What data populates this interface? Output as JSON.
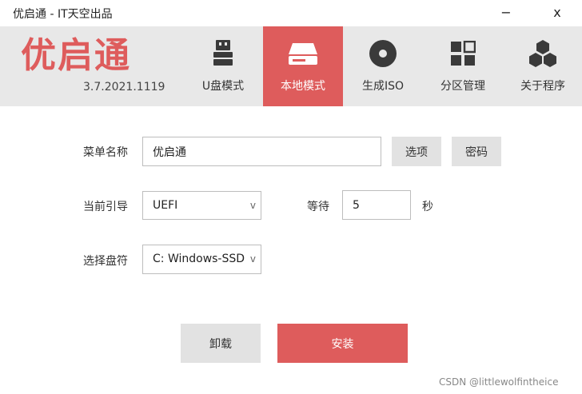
{
  "window": {
    "title": "优启通 - IT天空出品",
    "minimize_glyph": "−",
    "close_glyph": "x"
  },
  "header": {
    "logo_text": "优启通",
    "version": "3.7.2021.1119",
    "tabs": [
      {
        "label": "U盘模式",
        "icon": "usb-drive-icon",
        "active": false
      },
      {
        "label": "本地模式",
        "icon": "hard-disk-icon",
        "active": true
      },
      {
        "label": "生成ISO",
        "icon": "disc-icon",
        "active": false
      },
      {
        "label": "分区管理",
        "icon": "partition-grid-icon",
        "active": false
      },
      {
        "label": "关于程序",
        "icon": "hexagons-icon",
        "active": false
      }
    ]
  },
  "form": {
    "menu_name_label": "菜单名称",
    "menu_name_value": "优启通",
    "options_button": "选项",
    "password_button": "密码",
    "boot_label": "当前引导",
    "boot_value": "UEFI",
    "wait_label": "等待",
    "wait_value": "5",
    "seconds_unit": "秒",
    "drive_label": "选择盘符",
    "drive_value": "C: Windows-SSD",
    "chevron_glyph": "v"
  },
  "actions": {
    "uninstall_label": "卸载",
    "install_label": "安装"
  },
  "watermark": "CSDN @littlewolfintheice",
  "colors": {
    "accent": "#de5c5c",
    "header_bg": "#e8e8e8",
    "icon_dark": "#3a3a3a"
  }
}
